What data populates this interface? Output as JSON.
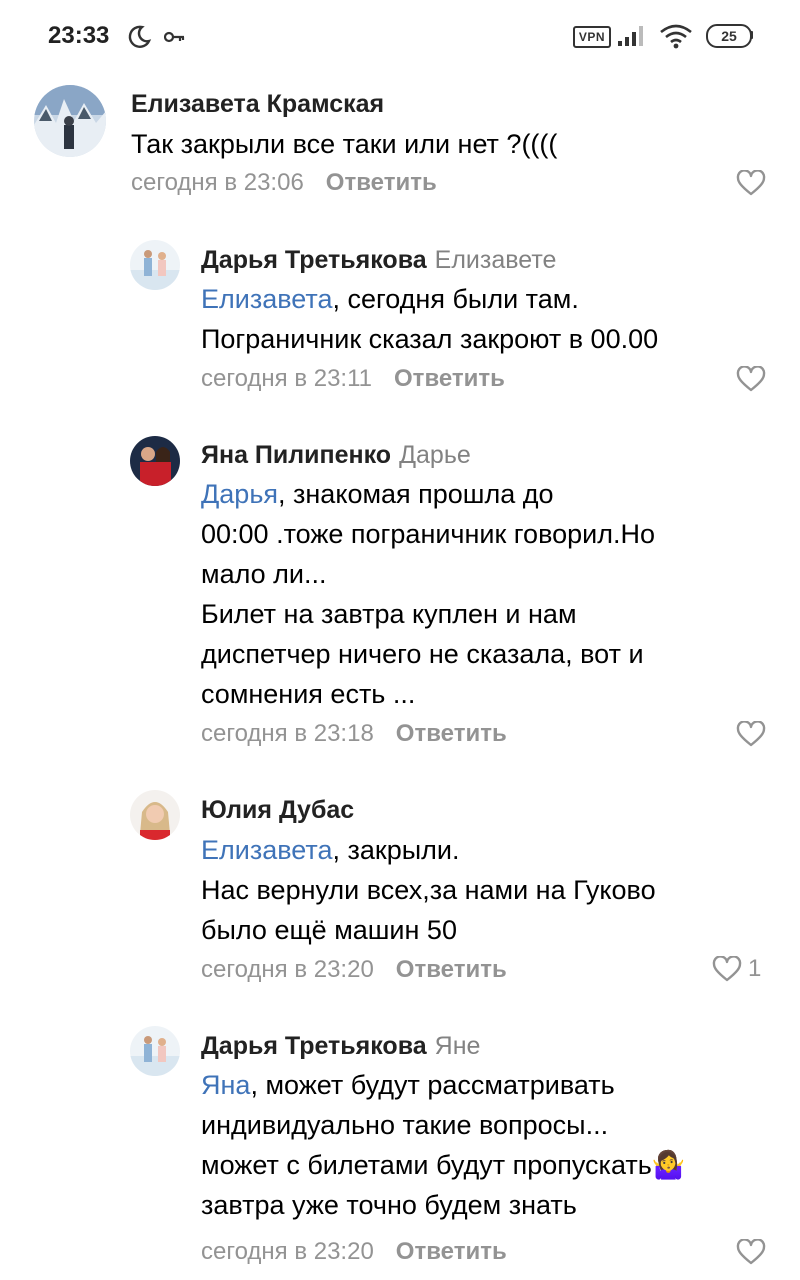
{
  "status_bar": {
    "time": "23:33",
    "vpn_label": "VPN",
    "battery": "25",
    "icons": [
      "moon-icon",
      "key-icon",
      "signal-icon",
      "wifi-icon",
      "battery-icon"
    ]
  },
  "colors": {
    "mention": "#3f73b8",
    "meta": "#939393",
    "author": "#222222"
  },
  "comments": [
    {
      "author": "Елизавета Крамская",
      "reply_to": "",
      "lines": [
        "Так закрыли все таки или нет ?(((("
      ],
      "time": "сегодня в 23:06",
      "reply_label": "Ответить",
      "likes": ""
    },
    {
      "author": "Дарья Третьякова",
      "reply_to": "Елизавете",
      "mention": "Елизавета",
      "lines": [
        ", сегодня были там.",
        "Пограничник сказал закроют в 00.00"
      ],
      "time": "сегодня в 23:11",
      "reply_label": "Ответить",
      "likes": ""
    },
    {
      "author": "Яна Пилипенко",
      "reply_to": "Дарье",
      "mention": "Дарья",
      "lines": [
        ", знакомая прошла до",
        "00:00 .тоже пограничник говорил.Но",
        "мало ли...",
        "Билет на завтра куплен и нам",
        "диспетчер ничего не сказала, вот и",
        "сомнения есть ..."
      ],
      "time": "сегодня в 23:18",
      "reply_label": "Ответить",
      "likes": ""
    },
    {
      "author": "Юлия Дубас",
      "reply_to": "",
      "mention": "Елизавета",
      "lines": [
        ", закрыли.",
        "Нас вернули всех,за нами на Гуково",
        "было ещё машин 50"
      ],
      "time": "сегодня в 23:20",
      "reply_label": "Ответить",
      "likes": "1"
    },
    {
      "author": "Дарья Третьякова",
      "reply_to": "Яне",
      "mention": "Яна",
      "lines": [
        ", может будут рассматривать",
        "индивидуально такие вопросы...",
        "может с билетами будут пропускать🤷‍♀️",
        "завтра уже точно будем знать"
      ],
      "time": "сегодня в 23:20",
      "reply_label": "Ответить",
      "likes": ""
    }
  ]
}
